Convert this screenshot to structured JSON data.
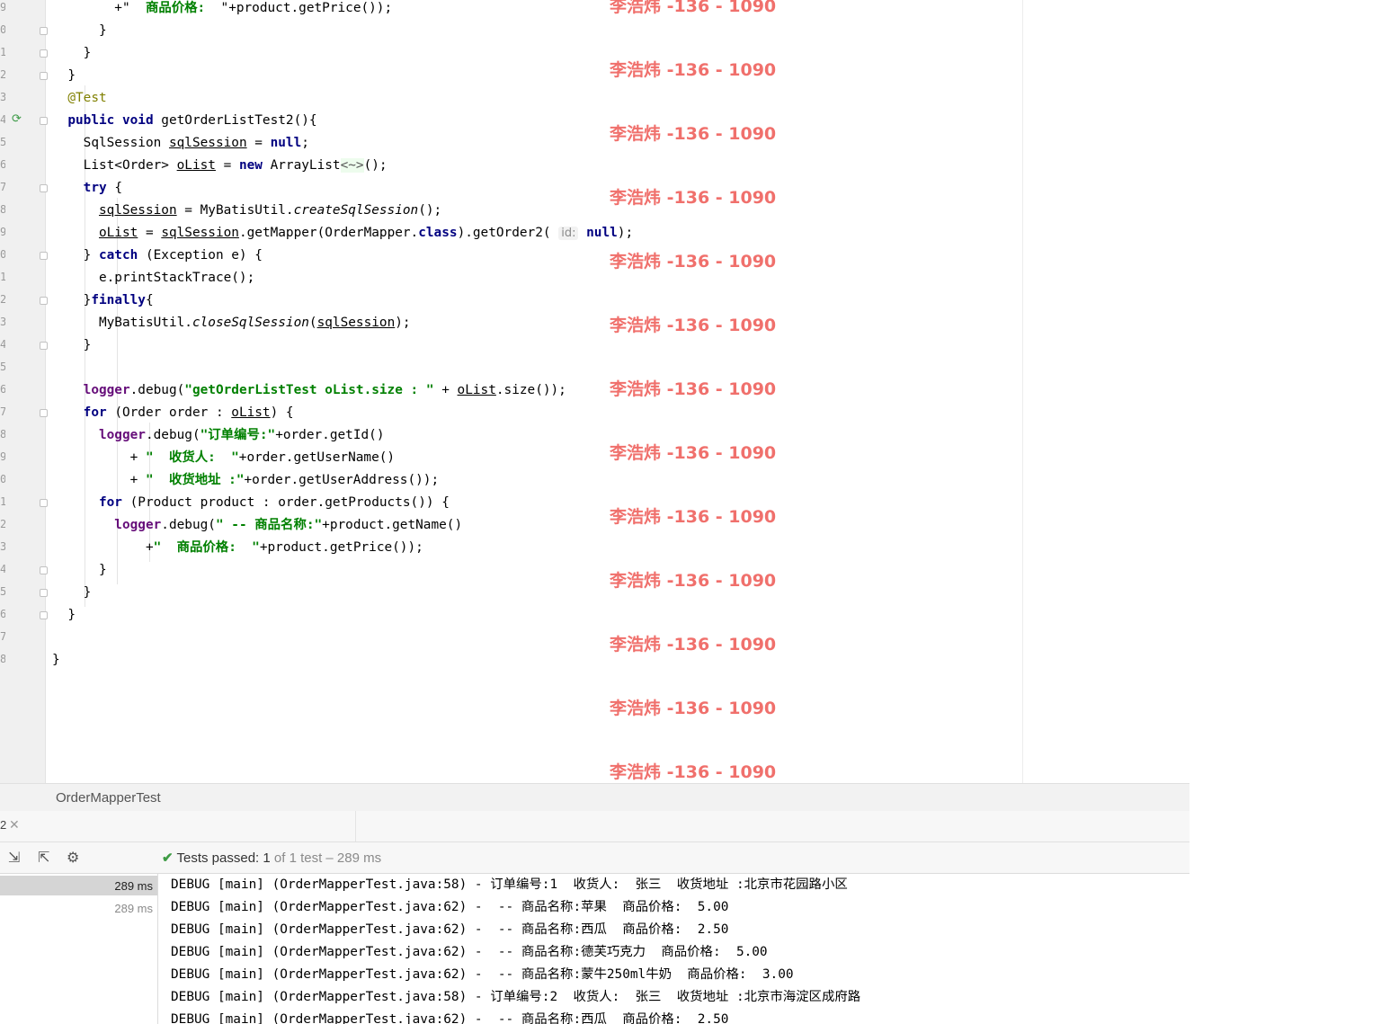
{
  "editor": {
    "line_numbers": [
      "9",
      "0",
      "1",
      "2",
      "3",
      "4",
      "5",
      "6",
      "7",
      "8",
      "9",
      "0",
      "1",
      "2",
      "3",
      "4",
      "5",
      "6",
      "7",
      "8",
      "9",
      "0",
      "1",
      "2",
      "3",
      "4",
      "5",
      "6",
      "7",
      "8"
    ],
    "code_lines": [
      [
        [
          "",
          "        +\"  "
        ],
        [
          "str",
          "商品价格:  "
        ],
        [
          "",
          "\"+product.getPrice());"
        ]
      ],
      [
        [
          "",
          "      }"
        ]
      ],
      [
        [
          "",
          "    }"
        ]
      ],
      [
        [
          "",
          "  }"
        ]
      ],
      [
        [
          "ann",
          "  @Test"
        ]
      ],
      [
        [
          "kw",
          "  public void "
        ],
        [
          "",
          "getOrderListTest2(){"
        ]
      ],
      [
        [
          "",
          "    SqlSession "
        ],
        [
          "ul",
          "sqlSession"
        ],
        [
          "",
          " = "
        ],
        [
          "kw",
          "null"
        ],
        [
          "",
          ";"
        ]
      ],
      [
        [
          "",
          "    List<Order> "
        ],
        [
          "ul",
          "oList"
        ],
        [
          "",
          " = "
        ],
        [
          "kw",
          "new "
        ],
        [
          "",
          "ArrayList"
        ],
        [
          "diam",
          "<~>"
        ],
        [
          "",
          "();"
        ]
      ],
      [
        [
          "kw",
          "    try "
        ],
        [
          "",
          "{"
        ]
      ],
      [
        [
          "",
          "      "
        ],
        [
          "ul",
          "sqlSession"
        ],
        [
          "",
          " = MyBatisUtil."
        ],
        [
          "it",
          "createSqlSession"
        ],
        [
          "",
          "();"
        ]
      ],
      [
        [
          "",
          "      "
        ],
        [
          "ul",
          "oList"
        ],
        [
          "",
          " = "
        ],
        [
          "ul",
          "sqlSession"
        ],
        [
          "",
          ".getMapper(OrderMapper."
        ],
        [
          "kw",
          "class"
        ],
        [
          "",
          ").getOrder2( "
        ],
        [
          "hint",
          "id:"
        ],
        [
          "",
          " "
        ],
        [
          "kw",
          "null"
        ],
        [
          "",
          ");"
        ]
      ],
      [
        [
          "",
          "    } "
        ],
        [
          "kw",
          "catch "
        ],
        [
          "",
          "(Exception e) {"
        ]
      ],
      [
        [
          "",
          "      e.printStackTrace();"
        ]
      ],
      [
        [
          "",
          "    }"
        ],
        [
          "kw",
          "finally"
        ],
        [
          "",
          "{"
        ]
      ],
      [
        [
          "",
          "      MyBatisUtil."
        ],
        [
          "it",
          "closeSqlSession"
        ],
        [
          "",
          "("
        ],
        [
          "ul",
          "sqlSession"
        ],
        [
          "",
          ");"
        ]
      ],
      [
        [
          "",
          "    }"
        ]
      ],
      [
        [
          "",
          ""
        ]
      ],
      [
        [
          "fld",
          "    logger"
        ],
        [
          "",
          ".debug("
        ],
        [
          "str",
          "\"getOrderListTest oList.size : \""
        ],
        [
          "",
          " + "
        ],
        [
          "ul",
          "oList"
        ],
        [
          "",
          ".size());"
        ]
      ],
      [
        [
          "kw",
          "    for "
        ],
        [
          "",
          "(Order order : "
        ],
        [
          "ul",
          "oList"
        ],
        [
          "",
          ") {"
        ]
      ],
      [
        [
          "fld",
          "      logger"
        ],
        [
          "",
          ".debug("
        ],
        [
          "str",
          "\"订单编号:\""
        ],
        [
          "",
          "+order.getId()"
        ]
      ],
      [
        [
          "",
          "          + "
        ],
        [
          "str",
          "\"  收货人:  \""
        ],
        [
          "",
          "+order.getUserName()"
        ]
      ],
      [
        [
          "",
          "          + "
        ],
        [
          "str",
          "\"  收货地址 :\""
        ],
        [
          "",
          "+order.getUserAddress());"
        ]
      ],
      [
        [
          "kw",
          "      for "
        ],
        [
          "",
          "(Product product : order.getProducts()) {"
        ]
      ],
      [
        [
          "fld",
          "        logger"
        ],
        [
          "",
          ".debug("
        ],
        [
          "str",
          "\" -- 商品名称:\""
        ],
        [
          "",
          "+product.getName()"
        ]
      ],
      [
        [
          "",
          "            +"
        ],
        [
          "str",
          "\"  商品价格:  \""
        ],
        [
          "",
          "+product.getPrice());"
        ]
      ],
      [
        [
          "",
          "      }"
        ]
      ],
      [
        [
          "",
          "    }"
        ]
      ],
      [
        [
          "",
          "  }"
        ]
      ],
      [
        [
          "",
          ""
        ]
      ],
      [
        [
          "",
          "}"
        ]
      ]
    ]
  },
  "watermark": "李浩炜 -136 - 1090",
  "tab": {
    "title": "OrderMapperTest"
  },
  "run_panel": {
    "label": "2",
    "status_prefix": "Tests passed: ",
    "status_count": "1",
    "status_suffix": " of 1 test – 289 ms"
  },
  "tree": [
    {
      "time": "289 ms",
      "selected": true
    },
    {
      "time": "289 ms",
      "selected": false
    }
  ],
  "console": [
    "DEBUG [main] (OrderMapperTest.java:58) - 订单编号:1  收货人:  张三  收货地址 :北京市花园路小区",
    "DEBUG [main] (OrderMapperTest.java:62) -  -- 商品名称:苹果  商品价格:  5.00",
    "DEBUG [main] (OrderMapperTest.java:62) -  -- 商品名称:西瓜  商品价格:  2.50",
    "DEBUG [main] (OrderMapperTest.java:62) -  -- 商品名称:德芙巧克力  商品价格:  5.00",
    "DEBUG [main] (OrderMapperTest.java:62) -  -- 商品名称:蒙牛250ml牛奶  商品价格:  3.00",
    "DEBUG [main] (OrderMapperTest.java:58) - 订单编号:2  收货人:  张三  收货地址 :北京市海淀区成府路",
    "DEBUG [main] (OrderMapperTest.java:62) -  -- 商品名称:西瓜  商品价格:  2.50"
  ],
  "icons": [
    "run-test-icon",
    "fold-marker-icon",
    "export-icon",
    "import-icon",
    "settings-gear-icon",
    "check-icon",
    "close-icon"
  ],
  "colors": {
    "keyword": "#000080",
    "string": "#008000",
    "field": "#660e7a",
    "annotation": "#808000",
    "watermark": "#f0706c",
    "pass": "#3e9b44"
  }
}
